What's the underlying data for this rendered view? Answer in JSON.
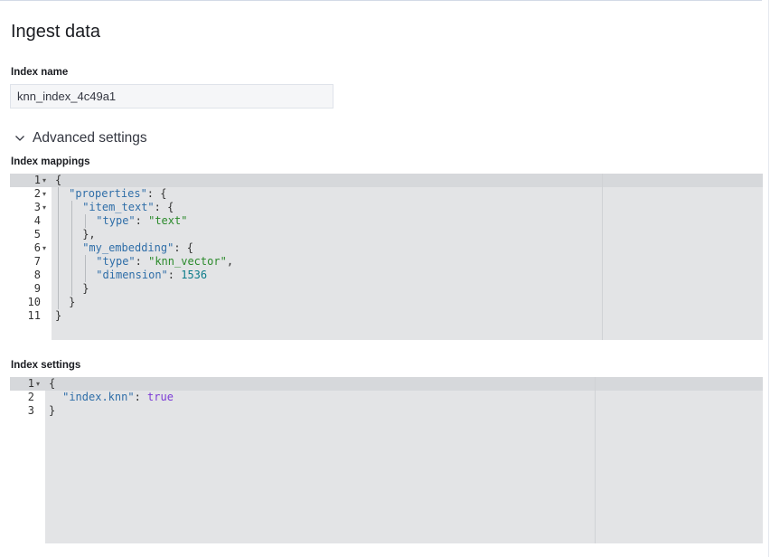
{
  "page": {
    "title": "Ingest data"
  },
  "index_name": {
    "label": "Index name",
    "value": "knn_index_4c49a1"
  },
  "advanced": {
    "label": "Advanced settings",
    "expanded": true,
    "icon": "chevron-down-icon"
  },
  "mappings": {
    "label": "Index mappings",
    "line_numbers": [
      "1",
      "2",
      "3",
      "4",
      "5",
      "6",
      "7",
      "8",
      "9",
      "10",
      "11"
    ],
    "foldable_lines": [
      "1",
      "2",
      "3",
      "6"
    ],
    "lines": [
      {
        "tokens": [
          {
            "t": "p",
            "v": "{"
          }
        ]
      },
      {
        "tokens": [
          {
            "t": "k",
            "v": "\"properties\""
          },
          {
            "t": "p",
            "v": ": {"
          }
        ]
      },
      {
        "tokens": [
          {
            "t": "k",
            "v": "\"item_text\""
          },
          {
            "t": "p",
            "v": ": {"
          }
        ]
      },
      {
        "tokens": [
          {
            "t": "k",
            "v": "\"type\""
          },
          {
            "t": "p",
            "v": ": "
          },
          {
            "t": "s",
            "v": "\"text\""
          }
        ]
      },
      {
        "tokens": [
          {
            "t": "p",
            "v": "},"
          }
        ]
      },
      {
        "tokens": [
          {
            "t": "k",
            "v": "\"my_embedding\""
          },
          {
            "t": "p",
            "v": ": {"
          }
        ]
      },
      {
        "tokens": [
          {
            "t": "k",
            "v": "\"type\""
          },
          {
            "t": "p",
            "v": ": "
          },
          {
            "t": "s",
            "v": "\"knn_vector\""
          },
          {
            "t": "p",
            "v": ","
          }
        ]
      },
      {
        "tokens": [
          {
            "t": "k",
            "v": "\"dimension\""
          },
          {
            "t": "p",
            "v": ": "
          },
          {
            "t": "n",
            "v": "1536"
          }
        ]
      },
      {
        "tokens": [
          {
            "t": "p",
            "v": "}"
          }
        ]
      },
      {
        "tokens": [
          {
            "t": "p",
            "v": "}"
          }
        ]
      },
      {
        "tokens": [
          {
            "t": "p",
            "v": "}"
          }
        ]
      }
    ]
  },
  "settings": {
    "label": "Index settings",
    "line_numbers": [
      "1",
      "2",
      "3"
    ],
    "foldable_lines": [
      "1"
    ],
    "lines": [
      {
        "tokens": [
          {
            "t": "p",
            "v": "{"
          }
        ]
      },
      {
        "tokens": [
          {
            "t": "k",
            "v": "\"index.knn\""
          },
          {
            "t": "p",
            "v": ": "
          },
          {
            "t": "b",
            "v": "true"
          }
        ]
      },
      {
        "tokens": [
          {
            "t": "p",
            "v": "}"
          }
        ]
      }
    ]
  }
}
